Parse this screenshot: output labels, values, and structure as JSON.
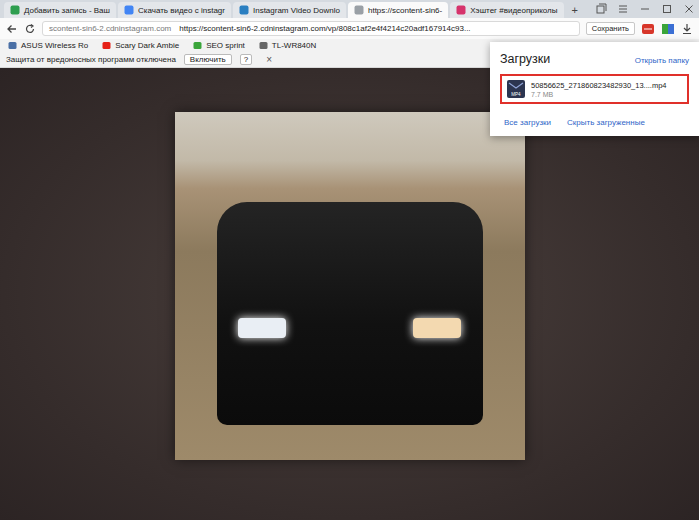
{
  "tabs": [
    {
      "label": "Добавить запись - Ваш",
      "selected": false,
      "color": "#2e9e4f"
    },
    {
      "label": "Скачать видео с instagr",
      "selected": false,
      "color": "#4285f4"
    },
    {
      "label": "Instagram Video Downlo",
      "selected": false,
      "color": "#2a7fc1"
    },
    {
      "label": "https://scontent-sin6-",
      "selected": true,
      "color": "#9aa0a6"
    },
    {
      "label": "Хэштег #видеоприколы",
      "selected": false,
      "color": "#d6336c"
    }
  ],
  "new_tab": "+",
  "address_bar": {
    "domain": "scontent-sin6-2.cdninstagram.com",
    "url": "https://scontent-sin6-2.cdninstagram.com/vp/808c1af2e4f4214c20adf167914c93...",
    "save_button": "Сохранить"
  },
  "bookmarks": [
    {
      "label": "ASUS Wireless Ro",
      "color": "#4a6fa5"
    },
    {
      "label": "Scary Dark Ambie",
      "color": "#e62117"
    },
    {
      "label": "SEO sprint",
      "color": "#3aa53a"
    },
    {
      "label": "TL-WR840N",
      "color": "#666666"
    }
  ],
  "warning_bar": {
    "message": "Защита от вредоносных программ отключена",
    "button": "Включить",
    "help": "?",
    "close": "×"
  },
  "downloads": {
    "title": "Загрузки",
    "open_folder": "Открыть папку",
    "items": [
      {
        "name": "50856625_271860823482930_13....mp4",
        "size": "7.7 MB",
        "type": "MP4",
        "highlighted": true
      }
    ],
    "all_downloads": "Все загрузки",
    "hide_downloaded": "Скрыть загруженные"
  }
}
